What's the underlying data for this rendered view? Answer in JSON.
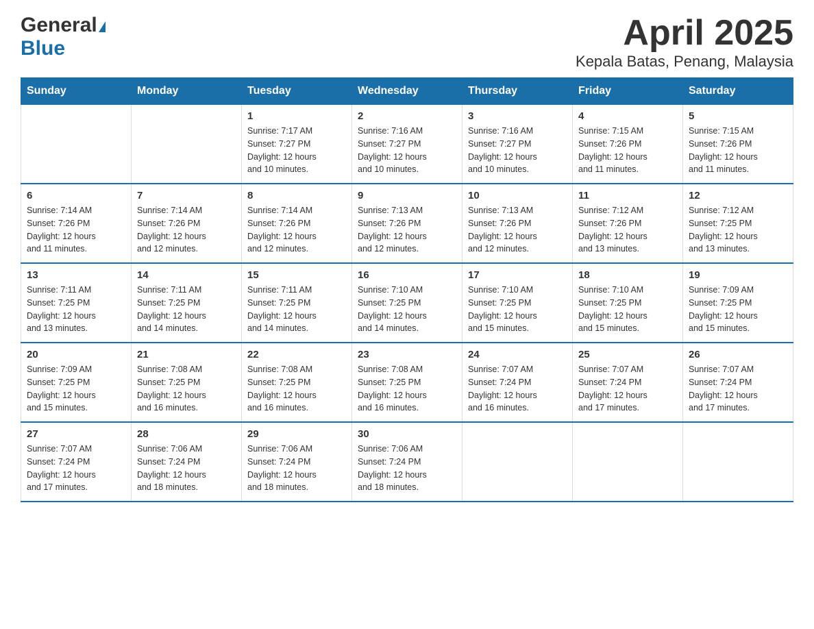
{
  "header": {
    "logo_general": "General",
    "logo_blue": "Blue",
    "title": "April 2025",
    "subtitle": "Kepala Batas, Penang, Malaysia"
  },
  "calendar": {
    "days_of_week": [
      "Sunday",
      "Monday",
      "Tuesday",
      "Wednesday",
      "Thursday",
      "Friday",
      "Saturday"
    ],
    "weeks": [
      [
        {
          "day": "",
          "info": ""
        },
        {
          "day": "",
          "info": ""
        },
        {
          "day": "1",
          "info": "Sunrise: 7:17 AM\nSunset: 7:27 PM\nDaylight: 12 hours\nand 10 minutes."
        },
        {
          "day": "2",
          "info": "Sunrise: 7:16 AM\nSunset: 7:27 PM\nDaylight: 12 hours\nand 10 minutes."
        },
        {
          "day": "3",
          "info": "Sunrise: 7:16 AM\nSunset: 7:27 PM\nDaylight: 12 hours\nand 10 minutes."
        },
        {
          "day": "4",
          "info": "Sunrise: 7:15 AM\nSunset: 7:26 PM\nDaylight: 12 hours\nand 11 minutes."
        },
        {
          "day": "5",
          "info": "Sunrise: 7:15 AM\nSunset: 7:26 PM\nDaylight: 12 hours\nand 11 minutes."
        }
      ],
      [
        {
          "day": "6",
          "info": "Sunrise: 7:14 AM\nSunset: 7:26 PM\nDaylight: 12 hours\nand 11 minutes."
        },
        {
          "day": "7",
          "info": "Sunrise: 7:14 AM\nSunset: 7:26 PM\nDaylight: 12 hours\nand 12 minutes."
        },
        {
          "day": "8",
          "info": "Sunrise: 7:14 AM\nSunset: 7:26 PM\nDaylight: 12 hours\nand 12 minutes."
        },
        {
          "day": "9",
          "info": "Sunrise: 7:13 AM\nSunset: 7:26 PM\nDaylight: 12 hours\nand 12 minutes."
        },
        {
          "day": "10",
          "info": "Sunrise: 7:13 AM\nSunset: 7:26 PM\nDaylight: 12 hours\nand 12 minutes."
        },
        {
          "day": "11",
          "info": "Sunrise: 7:12 AM\nSunset: 7:26 PM\nDaylight: 12 hours\nand 13 minutes."
        },
        {
          "day": "12",
          "info": "Sunrise: 7:12 AM\nSunset: 7:25 PM\nDaylight: 12 hours\nand 13 minutes."
        }
      ],
      [
        {
          "day": "13",
          "info": "Sunrise: 7:11 AM\nSunset: 7:25 PM\nDaylight: 12 hours\nand 13 minutes."
        },
        {
          "day": "14",
          "info": "Sunrise: 7:11 AM\nSunset: 7:25 PM\nDaylight: 12 hours\nand 14 minutes."
        },
        {
          "day": "15",
          "info": "Sunrise: 7:11 AM\nSunset: 7:25 PM\nDaylight: 12 hours\nand 14 minutes."
        },
        {
          "day": "16",
          "info": "Sunrise: 7:10 AM\nSunset: 7:25 PM\nDaylight: 12 hours\nand 14 minutes."
        },
        {
          "day": "17",
          "info": "Sunrise: 7:10 AM\nSunset: 7:25 PM\nDaylight: 12 hours\nand 15 minutes."
        },
        {
          "day": "18",
          "info": "Sunrise: 7:10 AM\nSunset: 7:25 PM\nDaylight: 12 hours\nand 15 minutes."
        },
        {
          "day": "19",
          "info": "Sunrise: 7:09 AM\nSunset: 7:25 PM\nDaylight: 12 hours\nand 15 minutes."
        }
      ],
      [
        {
          "day": "20",
          "info": "Sunrise: 7:09 AM\nSunset: 7:25 PM\nDaylight: 12 hours\nand 15 minutes."
        },
        {
          "day": "21",
          "info": "Sunrise: 7:08 AM\nSunset: 7:25 PM\nDaylight: 12 hours\nand 16 minutes."
        },
        {
          "day": "22",
          "info": "Sunrise: 7:08 AM\nSunset: 7:25 PM\nDaylight: 12 hours\nand 16 minutes."
        },
        {
          "day": "23",
          "info": "Sunrise: 7:08 AM\nSunset: 7:25 PM\nDaylight: 12 hours\nand 16 minutes."
        },
        {
          "day": "24",
          "info": "Sunrise: 7:07 AM\nSunset: 7:24 PM\nDaylight: 12 hours\nand 16 minutes."
        },
        {
          "day": "25",
          "info": "Sunrise: 7:07 AM\nSunset: 7:24 PM\nDaylight: 12 hours\nand 17 minutes."
        },
        {
          "day": "26",
          "info": "Sunrise: 7:07 AM\nSunset: 7:24 PM\nDaylight: 12 hours\nand 17 minutes."
        }
      ],
      [
        {
          "day": "27",
          "info": "Sunrise: 7:07 AM\nSunset: 7:24 PM\nDaylight: 12 hours\nand 17 minutes."
        },
        {
          "day": "28",
          "info": "Sunrise: 7:06 AM\nSunset: 7:24 PM\nDaylight: 12 hours\nand 18 minutes."
        },
        {
          "day": "29",
          "info": "Sunrise: 7:06 AM\nSunset: 7:24 PM\nDaylight: 12 hours\nand 18 minutes."
        },
        {
          "day": "30",
          "info": "Sunrise: 7:06 AM\nSunset: 7:24 PM\nDaylight: 12 hours\nand 18 minutes."
        },
        {
          "day": "",
          "info": ""
        },
        {
          "day": "",
          "info": ""
        },
        {
          "day": "",
          "info": ""
        }
      ]
    ]
  }
}
